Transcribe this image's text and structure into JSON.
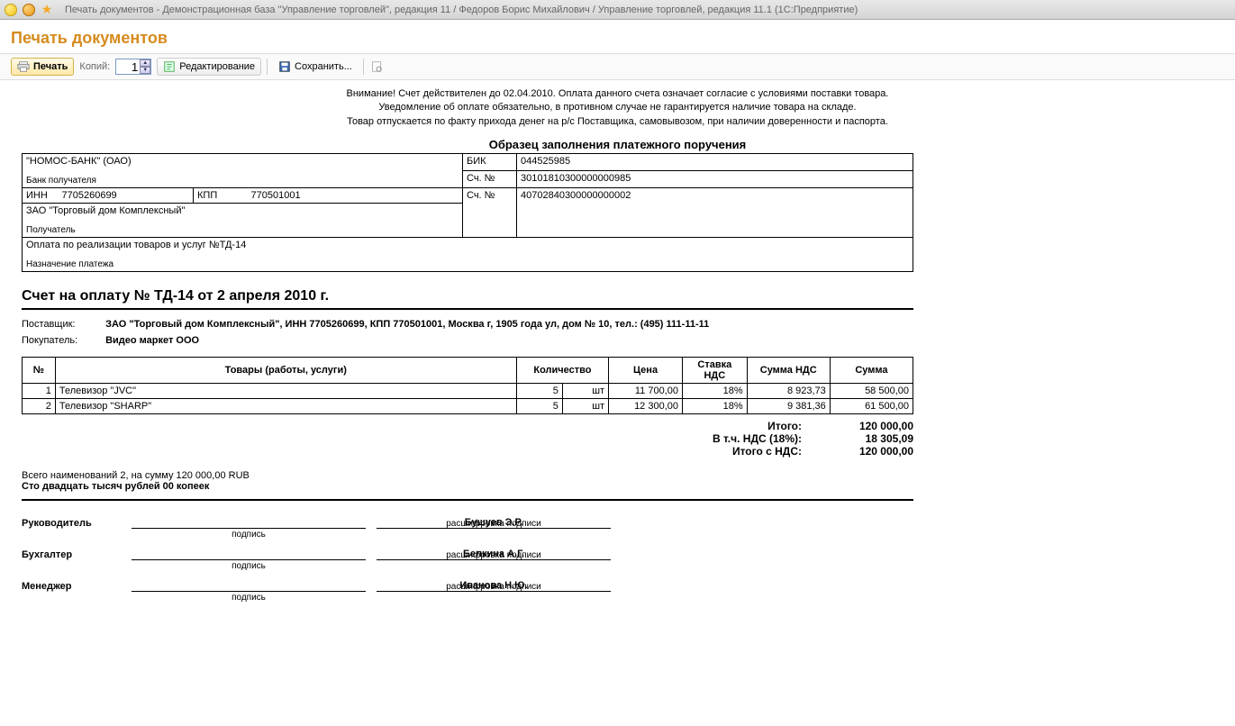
{
  "window": {
    "title": "Печать документов - Демонстрационная база \"Управление торговлей\", редакция 11 / Федоров Борис Михайлович / Управление торговлей, редакция 11.1  (1С:Предприятие)"
  },
  "header": {
    "page_title": "Печать документов"
  },
  "toolbar": {
    "print_label": "Печать",
    "copies_label": "Копий:",
    "copies_value": "1",
    "edit_label": "Редактирование",
    "save_label": "Сохранить..."
  },
  "notice": {
    "line1": "Внимание! Счет действителен до 02.04.2010. Оплата данного счета означает согласие с условиями поставки товара.",
    "line2": "Уведомление об оплате обязательно, в противном случае не гарантируется наличие товара на складе.",
    "line3": "Товар отпускается по факту прихода денег на р/с Поставщика, самовывозом, при наличии доверенности и паспорта."
  },
  "sample_title": "Образец заполнения платежного поручения",
  "bank": {
    "bank_name": "\"НОМОС-БАНК\" (ОАО)",
    "bank_recipient_label": "Банк получателя",
    "bik_label": "БИК",
    "bik_value": "044525985",
    "acct_label": "Сч. №",
    "bank_acct": "30101810300000000985",
    "inn_label": "ИНН",
    "inn_value": "7705260699",
    "kpp_label": "КПП",
    "kpp_value": "770501001",
    "acct2_label": "Сч. №",
    "recipient_acct": "40702840300000000002",
    "recipient_name": "ЗАО \"Торговый дом Комплексный\"",
    "recipient_label": "Получатель",
    "purpose": "Оплата по реализации товаров и услуг №ТД-14",
    "purpose_label": "Назначение платежа"
  },
  "invoice": {
    "title": "Счет на оплату № ТД-14 от 2 апреля 2010 г.",
    "supplier_label": "Поставщик:",
    "supplier_value": "ЗАО \"Торговый дом Комплексный\", ИНН 7705260699, КПП 770501001, Москва г, 1905 года ул, дом № 10, тел.: (495) 111-11-11",
    "buyer_label": "Покупатель:",
    "buyer_value": "Видео маркет ООО"
  },
  "items": {
    "headers": {
      "num": "№",
      "name": "Товары (работы, услуги)",
      "qty": "Количество",
      "price": "Цена",
      "vat_rate": "Ставка НДС",
      "vat_sum": "Сумма НДС",
      "sum": "Сумма"
    },
    "rows": [
      {
        "num": "1",
        "name": "Телевизор \"JVC\"",
        "qty": "5",
        "unit": "шт",
        "price": "11 700,00",
        "vat_rate": "18%",
        "vat_sum": "8 923,73",
        "sum": "58 500,00"
      },
      {
        "num": "2",
        "name": "Телевизор \"SHARP\"",
        "qty": "5",
        "unit": "шт",
        "price": "12 300,00",
        "vat_rate": "18%",
        "vat_sum": "9 381,36",
        "sum": "61 500,00"
      }
    ]
  },
  "totals": {
    "total_label": "Итого:",
    "total_value": "120 000,00",
    "vat_label": "В т.ч. НДС (18%):",
    "vat_value": "18 305,09",
    "total_vat_label": "Итого с НДС:",
    "total_vat_value": "120 000,00"
  },
  "summary": {
    "line": "Всего наименований 2, на сумму 120 000,00 RUB",
    "words": "Сто двадцать тысяч рублей 00 копеек"
  },
  "signatures": {
    "sign_caption": "подпись",
    "decode_caption": "расшифровка подписи",
    "rows": [
      {
        "role": "Руководитель",
        "name": "Бушуев Э.Р."
      },
      {
        "role": "Бухгалтер",
        "name": "Белкина А.Г."
      },
      {
        "role": "Менеджер",
        "name": "Иванова Н.Ю."
      }
    ]
  }
}
